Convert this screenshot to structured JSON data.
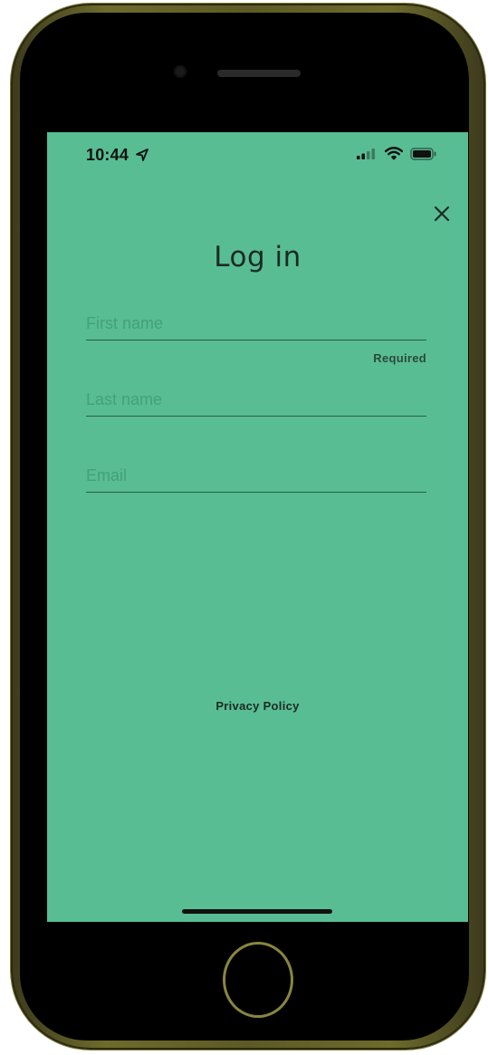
{
  "status_bar": {
    "time": "10:44",
    "location_icon": "location-arrow-icon",
    "signal_icon": "cellular-signal-icon",
    "wifi_icon": "wifi-icon",
    "battery_icon": "battery-icon"
  },
  "header": {
    "close_icon": "close-icon",
    "title": "Log in"
  },
  "form": {
    "first_name": {
      "placeholder": "First name",
      "value": "",
      "helper": "Required"
    },
    "last_name": {
      "placeholder": "Last name",
      "value": ""
    },
    "email": {
      "placeholder": "Email",
      "value": ""
    }
  },
  "footer": {
    "privacy_label": "Privacy Policy"
  },
  "colors": {
    "screen_background": "#58bd93",
    "text": "#1c2a24",
    "placeholder": "#43a07a",
    "device_frame": "#5d5a25"
  }
}
